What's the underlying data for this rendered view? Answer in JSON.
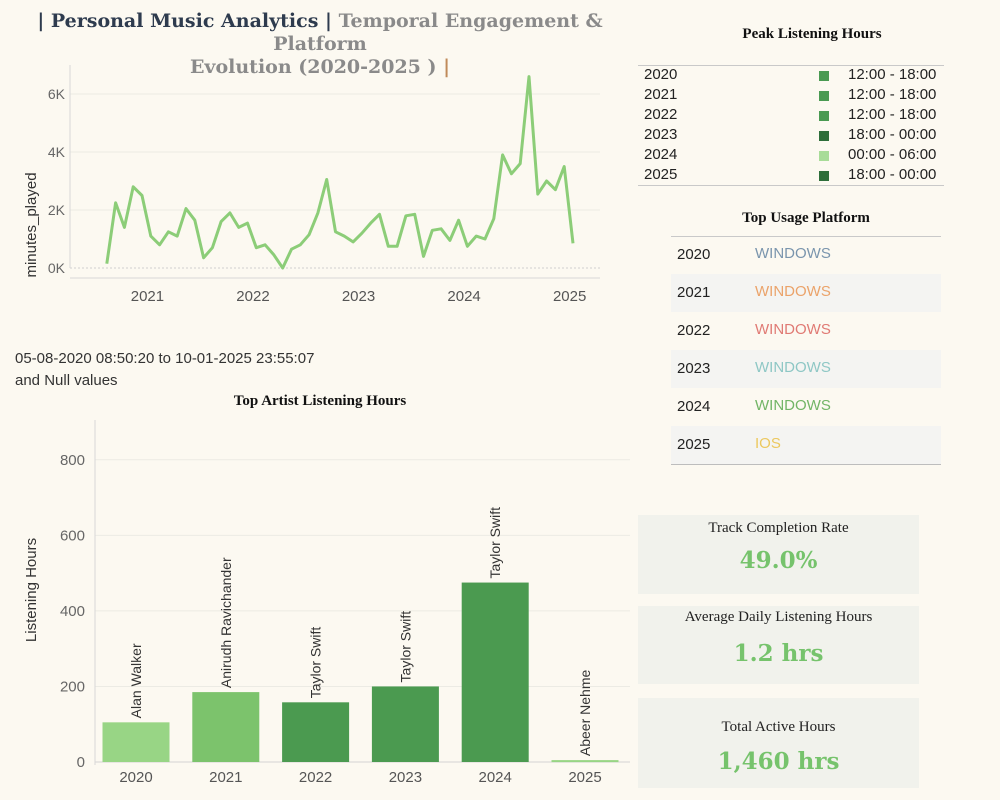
{
  "title": {
    "part1": "| Personal Music Analytics |",
    "part2": "Temporal Engagement & Platform",
    "part3": "Evolution (2020-2025 )",
    "part4": "|"
  },
  "peak_hours": {
    "title": "Peak Listening Hours",
    "rows": [
      {
        "year": "2020",
        "range": "12:00 - 18:00",
        "color": "#4a9a52"
      },
      {
        "year": "2021",
        "range": "12:00 - 18:00",
        "color": "#4a9a52"
      },
      {
        "year": "2022",
        "range": "12:00 - 18:00",
        "color": "#4a9a52"
      },
      {
        "year": "2023",
        "range": "18:00 - 00:00",
        "color": "#2e6e3a"
      },
      {
        "year": "2024",
        "range": "00:00 - 06:00",
        "color": "#a8dc98"
      },
      {
        "year": "2025",
        "range": "18:00 - 00:00",
        "color": "#2e6e3a"
      }
    ]
  },
  "platform": {
    "title": "Top Usage Platform",
    "rows": [
      {
        "year": "2020",
        "platform": "WINDOWS",
        "color": "#7a95ad"
      },
      {
        "year": "2021",
        "platform": "WINDOWS",
        "color": "#eba36a"
      },
      {
        "year": "2022",
        "platform": "WINDOWS",
        "color": "#e07a74"
      },
      {
        "year": "2023",
        "platform": "WINDOWS",
        "color": "#8ec7c5"
      },
      {
        "year": "2024",
        "platform": "WINDOWS",
        "color": "#72b566"
      },
      {
        "year": "2025",
        "platform": "IOS",
        "color": "#ecc85e"
      }
    ]
  },
  "date_range": {
    "line1": "05-08-2020 08:50:20 to 10-01-2025 23:55:07",
    "line2": "and Null values"
  },
  "kpis": {
    "completion": {
      "label": "Track Completion Rate",
      "value": "49.0%"
    },
    "daily": {
      "label": "Average Daily Listening Hours",
      "value": "1.2 hrs"
    },
    "total": {
      "label": "Total Active Hours",
      "value": "1,460 hrs"
    }
  },
  "chart_data": [
    {
      "type": "line",
      "title": "",
      "xlabel": "",
      "ylabel": "minutes_played",
      "ylim": [
        0,
        7000
      ],
      "yticks": [
        "0K",
        "2K",
        "4K",
        "6K"
      ],
      "xticks": [
        "2021",
        "2022",
        "2023",
        "2024",
        "2025"
      ],
      "color": "#8ccd78",
      "series": [
        {
          "x": [
            "2020-08",
            "2020-09",
            "2020-10",
            "2020-11",
            "2020-12",
            "2021-01",
            "2021-02",
            "2021-03",
            "2021-04",
            "2021-05",
            "2021-06",
            "2021-07",
            "2021-08",
            "2021-09",
            "2021-10",
            "2021-11",
            "2021-12",
            "2022-01",
            "2022-02",
            "2022-03",
            "2022-04",
            "2022-05",
            "2022-06",
            "2022-07",
            "2022-08",
            "2022-09",
            "2022-10",
            "2022-11",
            "2022-12",
            "2023-01",
            "2023-02",
            "2023-03",
            "2023-04",
            "2023-05",
            "2023-06",
            "2023-07",
            "2023-08",
            "2023-09",
            "2023-10",
            "2023-11",
            "2023-12",
            "2024-01",
            "2024-02",
            "2024-03",
            "2024-04",
            "2024-05",
            "2024-06",
            "2024-07",
            "2024-08",
            "2024-09",
            "2024-10",
            "2024-11",
            "2024-12",
            "2025-01"
          ],
          "values": [
            150,
            2250,
            1400,
            2800,
            2500,
            1100,
            800,
            1250,
            1100,
            2050,
            1650,
            350,
            700,
            1600,
            1900,
            1400,
            1550,
            700,
            800,
            450,
            0,
            650,
            800,
            1150,
            1900,
            3050,
            1250,
            1100,
            900,
            1200,
            1550,
            1850,
            750,
            750,
            1800,
            1850,
            400,
            1300,
            1350,
            950,
            1650,
            750,
            1100,
            1000,
            1700,
            3900,
            3250,
            3600,
            6600,
            2550,
            3000,
            2700,
            3500,
            850
          ]
        }
      ]
    },
    {
      "type": "bar",
      "title": "Top Artist Listening Hours",
      "xlabel": "",
      "ylabel": "Listening Hours",
      "ylim": [
        0,
        900
      ],
      "yticks": [
        0,
        200,
        400,
        600,
        800
      ],
      "categories": [
        "2020",
        "2021",
        "2022",
        "2023",
        "2024",
        "2025"
      ],
      "values": [
        105,
        185,
        158,
        200,
        475,
        5
      ],
      "labels": [
        "Alan Walker",
        "Anirudh Ravichander",
        "Taylor Swift",
        "Taylor Swift",
        "Taylor Swift",
        "Abeer Nehme"
      ],
      "colors": [
        "#98d585",
        "#7cc36c",
        "#4b9a50",
        "#4b9a50",
        "#4b9a50",
        "#98d585"
      ]
    }
  ]
}
